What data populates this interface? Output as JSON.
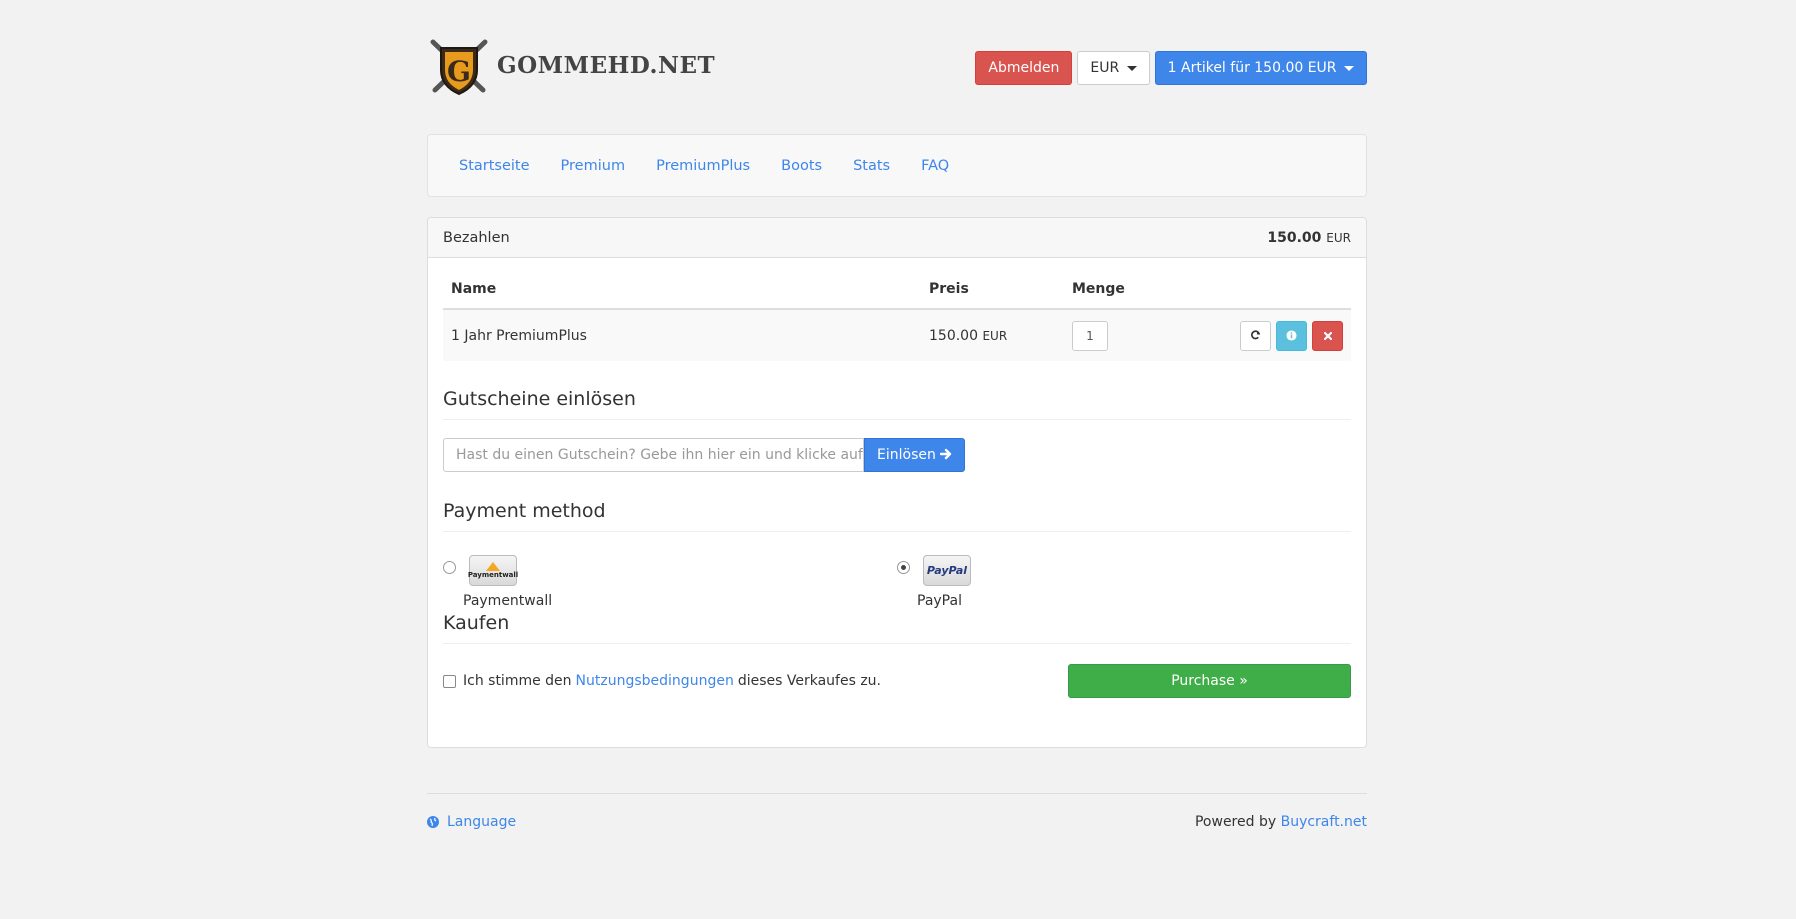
{
  "brand": {
    "name": "GOMMEHD.NET"
  },
  "header": {
    "logout": "Abmelden",
    "currency": "EUR",
    "cart": "1 Artikel für 150.00 EUR"
  },
  "nav": {
    "items": [
      "Startseite",
      "Premium",
      "PremiumPlus",
      "Boots",
      "Stats",
      "FAQ"
    ]
  },
  "panel": {
    "title": "Bezahlen",
    "total_value": "150.00",
    "total_currency": "EUR"
  },
  "table": {
    "headers": [
      "Name",
      "Preis",
      "Menge"
    ],
    "rows": [
      {
        "name": "1 Jahr PremiumPlus",
        "price": "150.00",
        "currency": "EUR",
        "qty": "1"
      }
    ]
  },
  "coupon": {
    "heading": "Gutscheine einlösen",
    "placeholder": "Hast du einen Gutschein? Gebe ihn hier ein und klicke auf Ein",
    "button": "Einlösen"
  },
  "payment": {
    "heading": "Payment method",
    "options": [
      {
        "label": "Paymentwall",
        "logo_text": "Paymentwall",
        "selected": false
      },
      {
        "label": "PayPal",
        "logo_text": "PayPal",
        "selected": true
      }
    ]
  },
  "buy": {
    "heading": "Kaufen",
    "agree_before": "Ich stimme den",
    "agree_link": "Nutzungsbedingungen",
    "agree_after": "dieses Verkaufes zu.",
    "button": "Purchase »"
  },
  "footer": {
    "language": "Language",
    "powered_by": "Powered by",
    "powered_link": "Buycraft.net"
  },
  "colors": {
    "primary": "#3e86ea",
    "danger": "#d9534f",
    "info": "#5bc0de",
    "success": "#3fae49"
  }
}
